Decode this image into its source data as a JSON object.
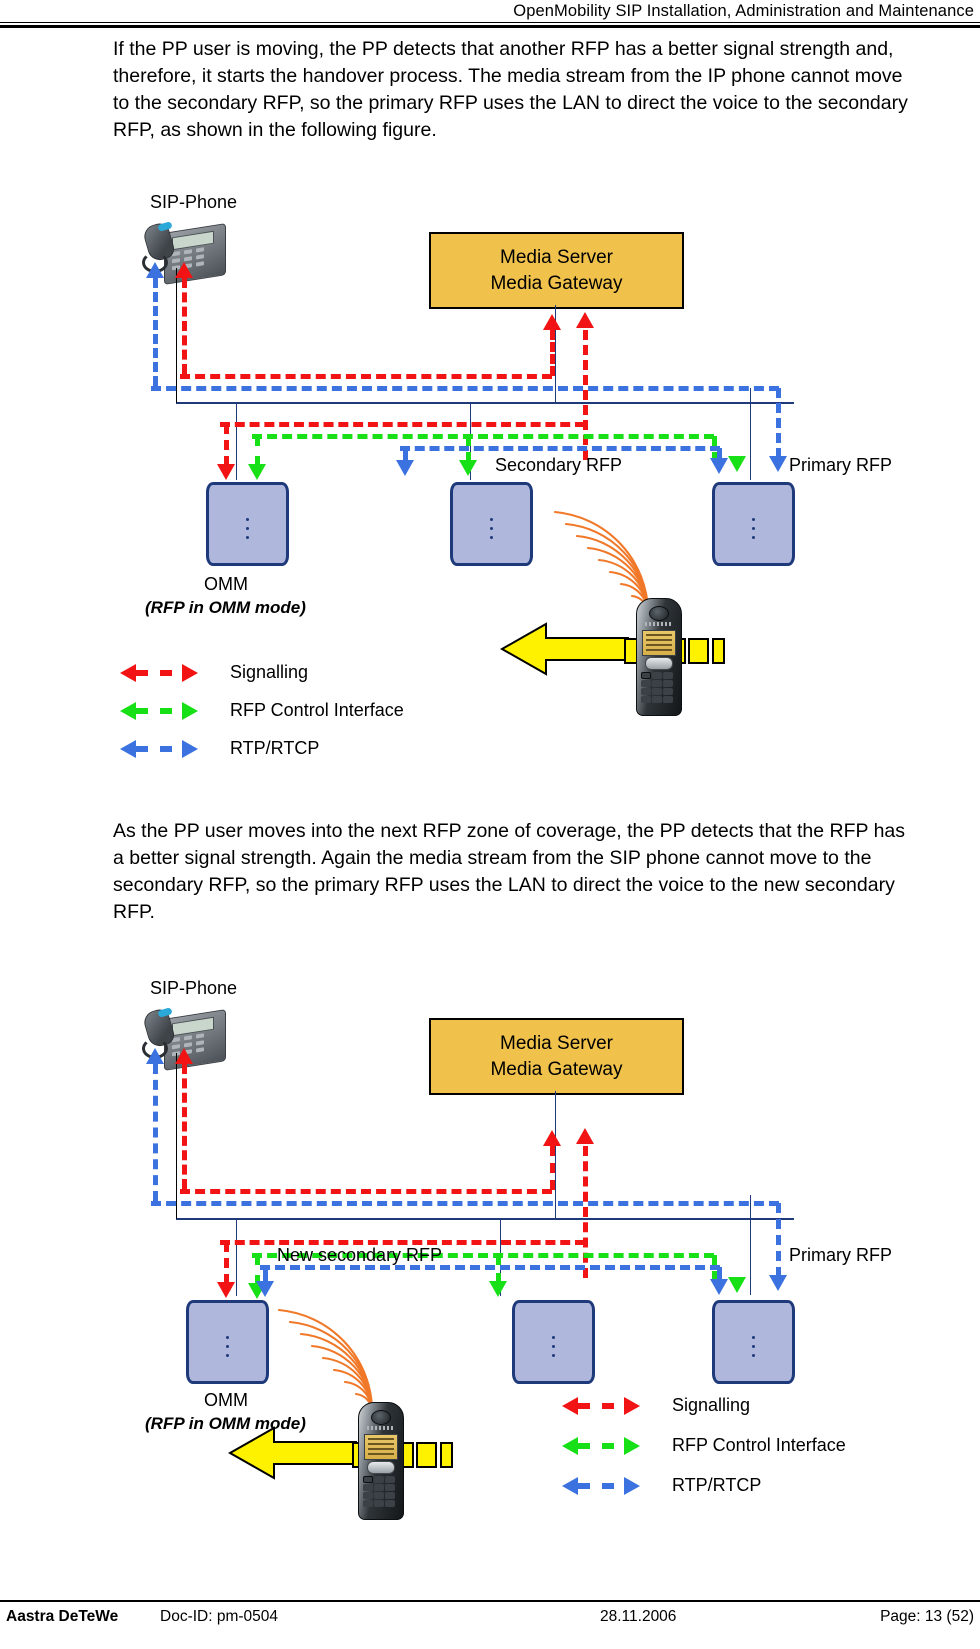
{
  "header": {
    "title": "OpenMobility SIP Installation, Administration and Maintenance"
  },
  "footer": {
    "company": "Aastra DeTeWe",
    "doc_id": "Doc-ID: pm-0504",
    "date": "28.11.2006",
    "page": "Page: 13 (52)"
  },
  "paragraphs": {
    "first": "If the PP user is moving, the PP detects that another RFP has a better signal strength and, therefore, it starts the handover process. The media stream from the IP phone cannot move to the secondary RFP, so the primary RFP uses the LAN to direct the voice to the secondary RFP, as shown in the following figure.",
    "second": "As the PP user moves into the next RFP zone of coverage, the PP detects that the RFP has a better signal strength. Again the media stream from the SIP phone cannot move to the secondary RFP, so the primary RFP uses the LAN to direct the voice to the new secondary RFP."
  },
  "figure1": {
    "sip_phone_label": "SIP-Phone",
    "media_box_line1": "Media Server",
    "media_box_line2": "Media Gateway",
    "secondary_rfp_label": "Secondary RFP",
    "primary_rfp_label": "Primary RFP",
    "omm_label": "OMM",
    "omm_sub_label": "(RFP in OMM mode)",
    "legend": [
      {
        "label": "Signalling",
        "color": "#F21414",
        "name": "signalling"
      },
      {
        "label": " RFP Control Interface",
        "color": "#17E017",
        "name": "rfp-control-interface"
      },
      {
        "label": "RTP/RTCP",
        "color": "#3B72E0",
        "name": "rtp-rtcp"
      }
    ]
  },
  "figure2": {
    "sip_phone_label": "SIP-Phone",
    "media_box_line1": "Media Server",
    "media_box_line2": "Media Gateway",
    "new_secondary_rfp_label": "New secondary RFP",
    "primary_rfp_label": "Primary RFP",
    "omm_label": "OMM",
    "omm_sub_label": "(RFP in OMM mode)",
    "legend": [
      {
        "label": "Signalling",
        "color": "#F21414",
        "name": "signalling"
      },
      {
        "label": " RFP Control Interface",
        "color": "#17E017",
        "name": "rfp-control-interface"
      },
      {
        "label": "RTP/RTCP",
        "color": "#3B72E0",
        "name": "rtp-rtcp"
      }
    ]
  },
  "colors": {
    "signalling": "#F21414",
    "rfp_control": "#17E017",
    "rtp_rtcp": "#3B72E0",
    "media_box_fill": "#F0C24C",
    "rfp_fill": "#AFB8DC",
    "rfp_border": "#1F3A7A",
    "lan_line": "#1F3A7A",
    "motion_arrow": "#FFF200",
    "radio_wave": "#F07828"
  }
}
